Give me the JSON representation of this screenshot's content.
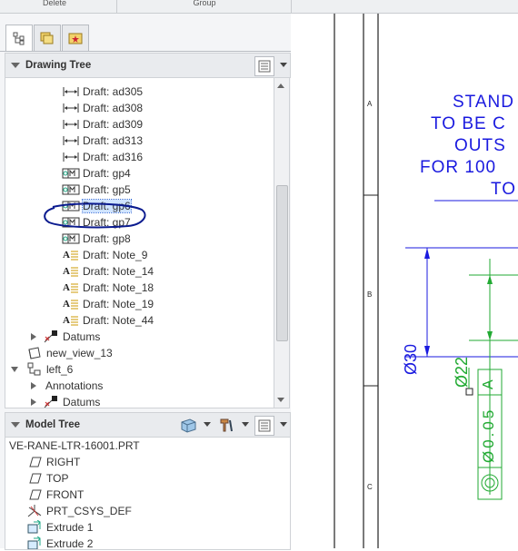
{
  "ribbon": {
    "delete_label": "Delete",
    "group_label": "Group"
  },
  "drawing_tree": {
    "title": "Drawing Tree",
    "items": [
      {
        "label": "Draft: ad305",
        "icon": "dimension-icon"
      },
      {
        "label": "Draft: ad308",
        "icon": "dimension-icon"
      },
      {
        "label": "Draft: ad309",
        "icon": "dimension-icon"
      },
      {
        "label": "Draft: ad313",
        "icon": "dimension-icon"
      },
      {
        "label": "Draft: ad316",
        "icon": "dimension-icon"
      },
      {
        "label": "Draft: gp4",
        "icon": "geometric-tolerance-icon"
      },
      {
        "label": "Draft: gp5",
        "icon": "geometric-tolerance-icon"
      },
      {
        "label": "Draft: gp6",
        "icon": "geometric-tolerance-icon",
        "selected": true
      },
      {
        "label": "Draft: gp7",
        "icon": "geometric-tolerance-icon"
      },
      {
        "label": "Draft: gp8",
        "icon": "geometric-tolerance-icon"
      },
      {
        "label": "Draft: Note_9",
        "icon": "note-icon"
      },
      {
        "label": "Draft: Note_14",
        "icon": "note-icon"
      },
      {
        "label": "Draft: Note_18",
        "icon": "note-icon"
      },
      {
        "label": "Draft: Note_19",
        "icon": "note-icon"
      },
      {
        "label": "Draft: Note_44",
        "icon": "note-icon"
      }
    ],
    "datums1": "Datums",
    "view1": "new_view_13",
    "view2": "left_6",
    "annotations": "Annotations",
    "datums2": "Datums"
  },
  "model_tree": {
    "title": "Model Tree",
    "root": "VE-RANE-LTR-16001.PRT",
    "items": [
      {
        "label": "RIGHT",
        "icon": "datum-plane-icon"
      },
      {
        "label": "TOP",
        "icon": "datum-plane-icon"
      },
      {
        "label": "FRONT",
        "icon": "datum-plane-icon"
      },
      {
        "label": "PRT_CSYS_DEF",
        "icon": "csys-icon"
      },
      {
        "label": "Extrude 1",
        "icon": "extrude-icon"
      },
      {
        "label": "Extrude 2",
        "icon": "extrude-icon"
      }
    ]
  },
  "drawing": {
    "zone_a": "A",
    "zone_b": "B",
    "zone_c": "C",
    "note_lines": [
      "STAND",
      "TO BE C",
      "OUTS",
      "FOR 100",
      "TO"
    ],
    "dim_30": "Ø30",
    "dim_22": "Ø22",
    "datum_a": "A",
    "tol": "Ø0.05",
    "colors": {
      "blue": "#1a1adf",
      "green": "#22aa33"
    }
  }
}
